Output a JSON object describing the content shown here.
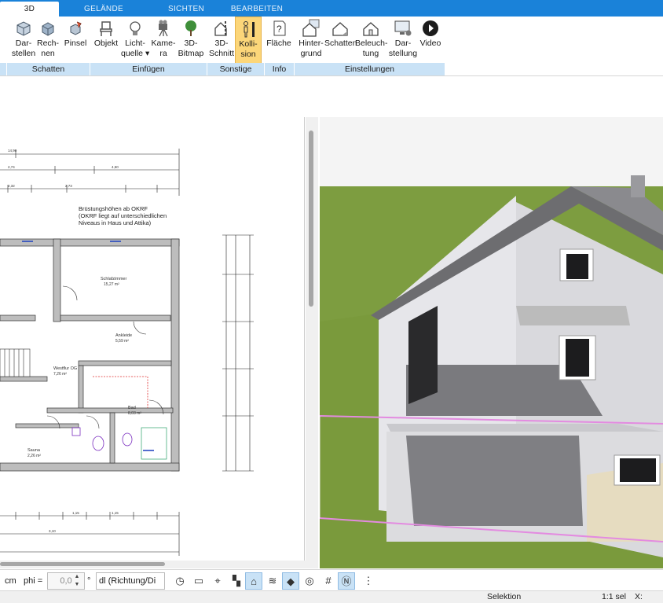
{
  "tabs": [
    {
      "label": "3D"
    },
    {
      "label": "GELÄNDE"
    },
    {
      "label": "SICHTEN"
    },
    {
      "label": "BEARBEITEN"
    }
  ],
  "ribbon": {
    "buttons": [
      {
        "label": "Dar-\nstellen",
        "icon": "cube-display-icon"
      },
      {
        "label": "Rech-\nnen",
        "icon": "cube-render-icon"
      },
      {
        "label": "Pinsel",
        "icon": "paint-brush-icon"
      },
      {
        "label": "Objekt",
        "icon": "chair-icon"
      },
      {
        "label": "Licht-\nquelle ▾",
        "icon": "light-bulb-icon"
      },
      {
        "label": "Kame-\nra",
        "icon": "camera-icon"
      },
      {
        "label": "3D-\nBitmap",
        "icon": "tree-icon"
      },
      {
        "label": "3D-\nSchnitt",
        "icon": "section-cut-icon"
      },
      {
        "label": "Kolli-\nsion",
        "icon": "collision-person-icon"
      },
      {
        "label": "Fläche",
        "icon": "area-info-icon"
      },
      {
        "label": "Hinter-\ngrund",
        "icon": "house-background-icon"
      },
      {
        "label": "Schatten",
        "icon": "house-shadow-icon"
      },
      {
        "label": "Beleuch-\ntung",
        "icon": "house-lighting-icon"
      },
      {
        "label": "Dar-\nstellung",
        "icon": "monitor-settings-icon"
      },
      {
        "label": "Video",
        "icon": "play-video-icon"
      }
    ],
    "groups": [
      {
        "label": "Schatten"
      },
      {
        "label": "Einfügen"
      },
      {
        "label": "Sonstige"
      },
      {
        "label": "Info"
      },
      {
        "label": "Einstellungen"
      }
    ]
  },
  "plan": {
    "note": "Brüstungshöhen ab OKRF\n(OKRF liegt auf unterschiedlichen\nNiveaus in Haus und Attika)",
    "rooms": [
      {
        "name": "Schlafzimmer",
        "area": "15,27 m²"
      },
      {
        "name": "Ankleide",
        "area": "5,59 m²"
      },
      {
        "name": "Westflur OG",
        "area": "7,26 m²"
      },
      {
        "name": "Bad",
        "area": "8,03 m²"
      },
      {
        "name": "Sauna",
        "area": "2,26 m²"
      }
    ],
    "dims_top": [
      "14,90",
      "2,74",
      "4,50",
      "2,73",
      "2,32"
    ],
    "dims_bottom": [
      "1,15",
      "1,15",
      "3,10"
    ]
  },
  "toolbar": {
    "unit": "cm",
    "phi_label": "phi =",
    "phi_value": "0,0",
    "degree": "°",
    "direction_value": "dl (Richtung/Di"
  },
  "status": {
    "mode": "Selektion",
    "scale": "1:1 sel",
    "x_label": "X:"
  }
}
